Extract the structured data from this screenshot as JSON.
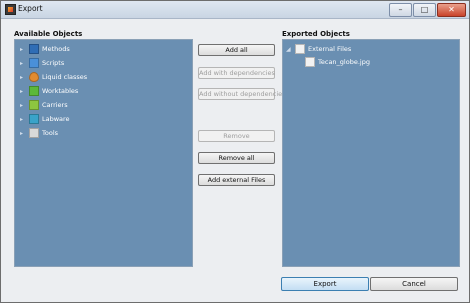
{
  "window": {
    "title": "Export"
  },
  "window_controls": {
    "minimize": "–",
    "maximize": "□",
    "close": "✕"
  },
  "available": {
    "label": "Available Objects",
    "items": [
      {
        "label": "Methods",
        "icon": "methods-icon",
        "color": "#2f6db5"
      },
      {
        "label": "Scripts",
        "icon": "scripts-icon",
        "color": "#4a90d9"
      },
      {
        "label": "Liquid classes",
        "icon": "liquid-classes-icon",
        "color": "#e28b2f"
      },
      {
        "label": "Worktables",
        "icon": "worktables-icon",
        "color": "#5cb83a"
      },
      {
        "label": "Carriers",
        "icon": "carriers-icon",
        "color": "#8dc63f"
      },
      {
        "label": "Labware",
        "icon": "labware-icon",
        "color": "#3aa3c9"
      },
      {
        "label": "Tools",
        "icon": "tools-icon",
        "color": "#d9d9d9"
      }
    ]
  },
  "actions": {
    "add_all": "Add all",
    "add_with_dependencies": "Add with dependencies",
    "add_without_dependencies": "Add without dependencies",
    "remove": "Remove",
    "remove_all": "Remove all",
    "add_external_files": "Add external Files"
  },
  "exported": {
    "label": "Exported Objects",
    "root": "External Files",
    "child": "Tecan_globe.jpg"
  },
  "footer": {
    "export": "Export",
    "cancel": "Cancel"
  }
}
